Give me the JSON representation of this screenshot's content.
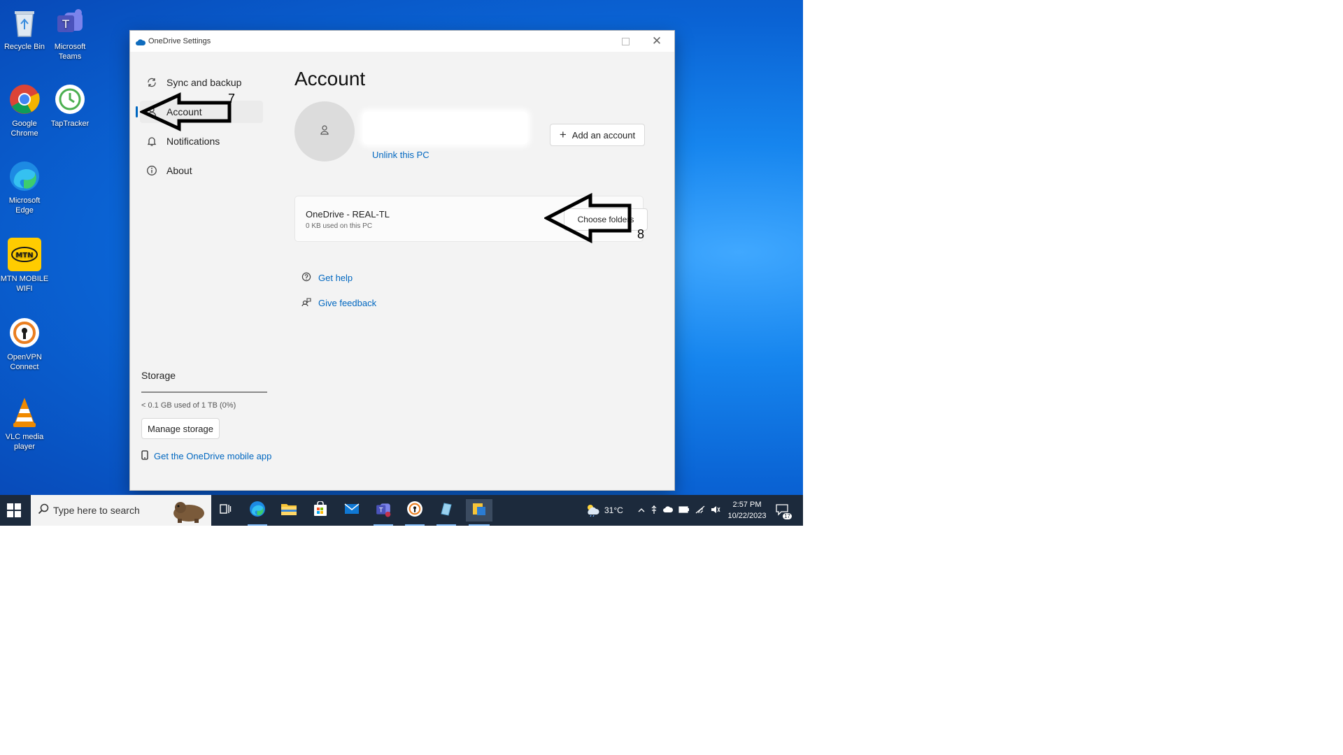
{
  "desktop": {
    "icons": [
      {
        "label": "Recycle Bin",
        "icon": "recycle-bin-icon"
      },
      {
        "label": "Microsoft Teams",
        "icon": "teams-icon"
      },
      {
        "label": "Google Chrome",
        "icon": "chrome-icon"
      },
      {
        "label": "TapTracker",
        "icon": "taptracker-icon"
      },
      {
        "label": "Microsoft Edge",
        "icon": "edge-icon"
      },
      {
        "label": "MTN MOBILE WIFI",
        "icon": "mtn-icon"
      },
      {
        "label": "OpenVPN Connect",
        "icon": "openvpn-icon"
      },
      {
        "label": "VLC media player",
        "icon": "vlc-icon"
      }
    ]
  },
  "window": {
    "title": "OneDrive Settings"
  },
  "nav": {
    "items": [
      {
        "label": "Sync and backup",
        "icon": "sync-icon"
      },
      {
        "label": "Account",
        "icon": "person-icon"
      },
      {
        "label": "Notifications",
        "icon": "bell-icon"
      },
      {
        "label": "About",
        "icon": "info-icon"
      }
    ],
    "active": "Account"
  },
  "storage": {
    "title": "Storage",
    "used": "< 0.1 GB used of 1 TB (0%)",
    "used_fraction": 0,
    "manage_label": "Manage storage",
    "mobile_link": "Get the OneDrive mobile app"
  },
  "account": {
    "page_title": "Account",
    "unlink": "Unlink this PC",
    "add_account": "Add an account",
    "card_title": "OneDrive - REAL-TL",
    "card_sub": "0 KB used on this PC",
    "choose_folders": "Choose folders",
    "get_help": "Get help",
    "give_feedback": "Give feedback"
  },
  "annotations": {
    "step_7": "7",
    "step_8": "8"
  },
  "taskbar": {
    "search_placeholder": "Type here to search",
    "weather": "31°C",
    "time": "2:57 PM",
    "date": "10/22/2023",
    "notification_count": "17"
  },
  "colors": {
    "accent": "#0067c0",
    "taskbar": "#1c2a3c"
  }
}
